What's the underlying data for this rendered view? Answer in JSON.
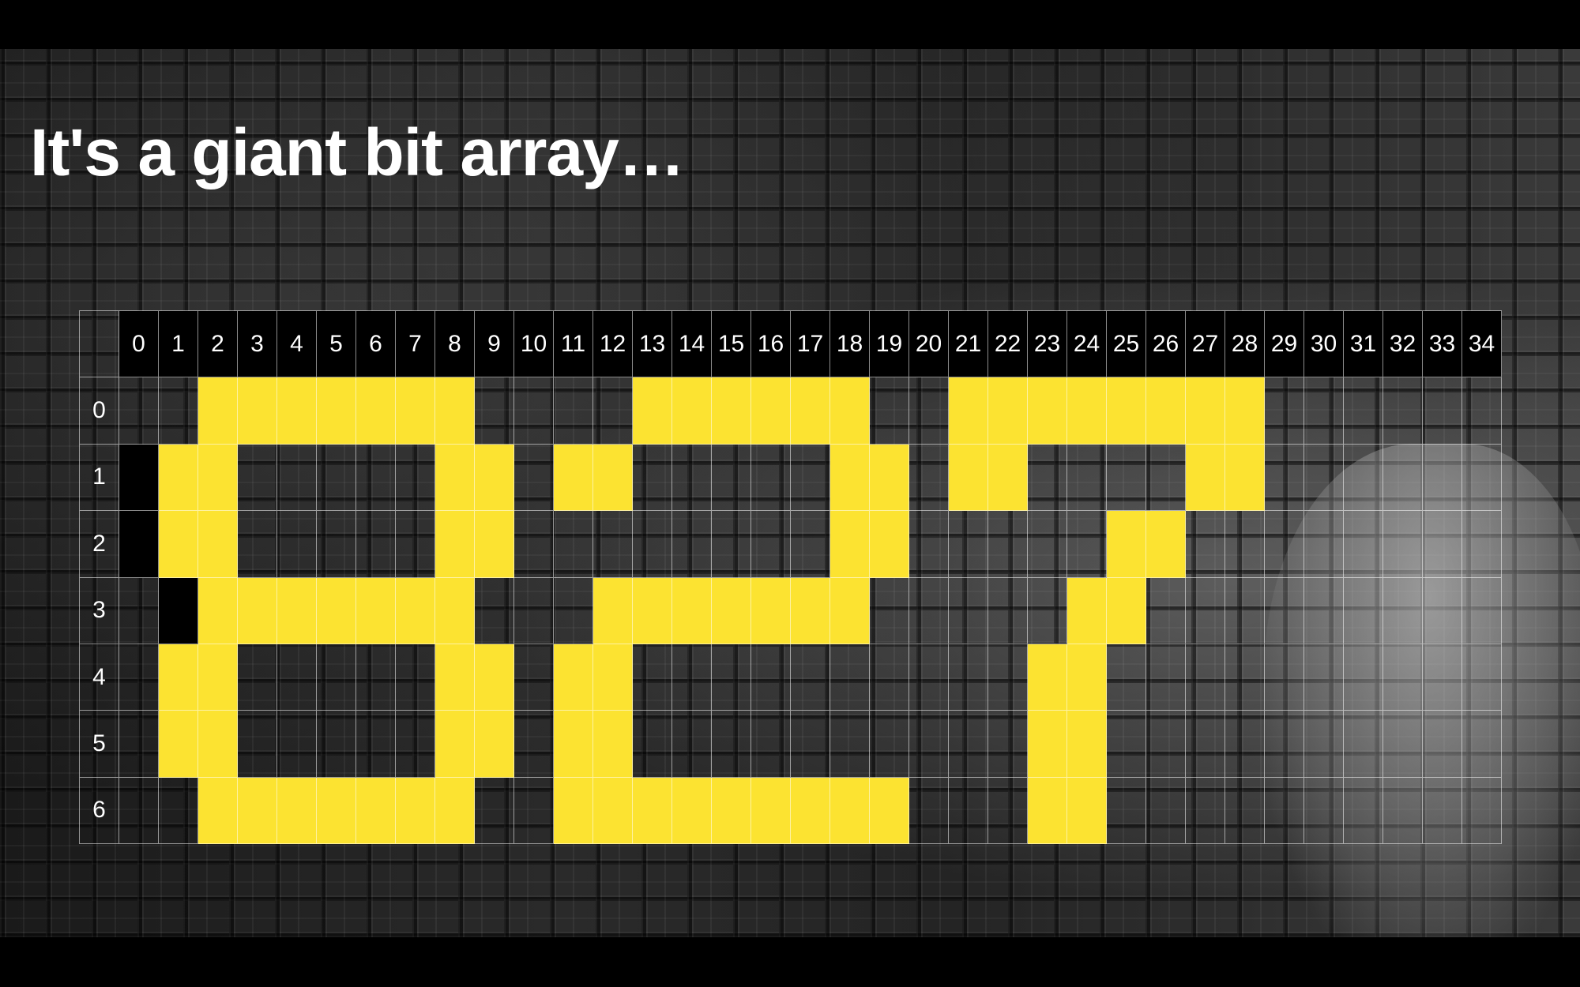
{
  "slide": {
    "title": "It's a giant bit array…"
  },
  "colors": {
    "bit_on": "#fce331",
    "header_band": "#000000",
    "grid_line": "#ffffff",
    "text": "#ffffff"
  },
  "grid": {
    "column_labels": [
      "0",
      "1",
      "2",
      "3",
      "4",
      "5",
      "6",
      "7",
      "8",
      "9",
      "10",
      "11",
      "12",
      "13",
      "14",
      "15",
      "16",
      "17",
      "18",
      "19",
      "20",
      "21",
      "22",
      "23",
      "24",
      "25",
      "26",
      "27",
      "28",
      "29",
      "30",
      "31",
      "32",
      "33",
      "34"
    ],
    "row_labels": [
      "0",
      "1",
      "2",
      "3",
      "4",
      "5",
      "6"
    ],
    "on_bits": [
      [
        2,
        3,
        4,
        5,
        6,
        7,
        8,
        13,
        14,
        15,
        16,
        17,
        18,
        21,
        22,
        23,
        24,
        25,
        26,
        27,
        28
      ],
      [
        1,
        2,
        8,
        9,
        11,
        12,
        18,
        19,
        21,
        22,
        27,
        28
      ],
      [
        1,
        2,
        8,
        9,
        18,
        19,
        25,
        26
      ],
      [
        2,
        3,
        4,
        5,
        6,
        7,
        8,
        12,
        13,
        14,
        15,
        16,
        17,
        18,
        24,
        25
      ],
      [
        1,
        2,
        8,
        9,
        11,
        12,
        23,
        24
      ],
      [
        1,
        2,
        8,
        9,
        11,
        12,
        23,
        24
      ],
      [
        2,
        3,
        4,
        5,
        6,
        7,
        8,
        11,
        12,
        13,
        14,
        15,
        16,
        17,
        18,
        19,
        23,
        24
      ]
    ],
    "dark_bits": [
      [],
      [
        0
      ],
      [
        0
      ],
      [
        1
      ],
      [],
      [],
      []
    ]
  }
}
